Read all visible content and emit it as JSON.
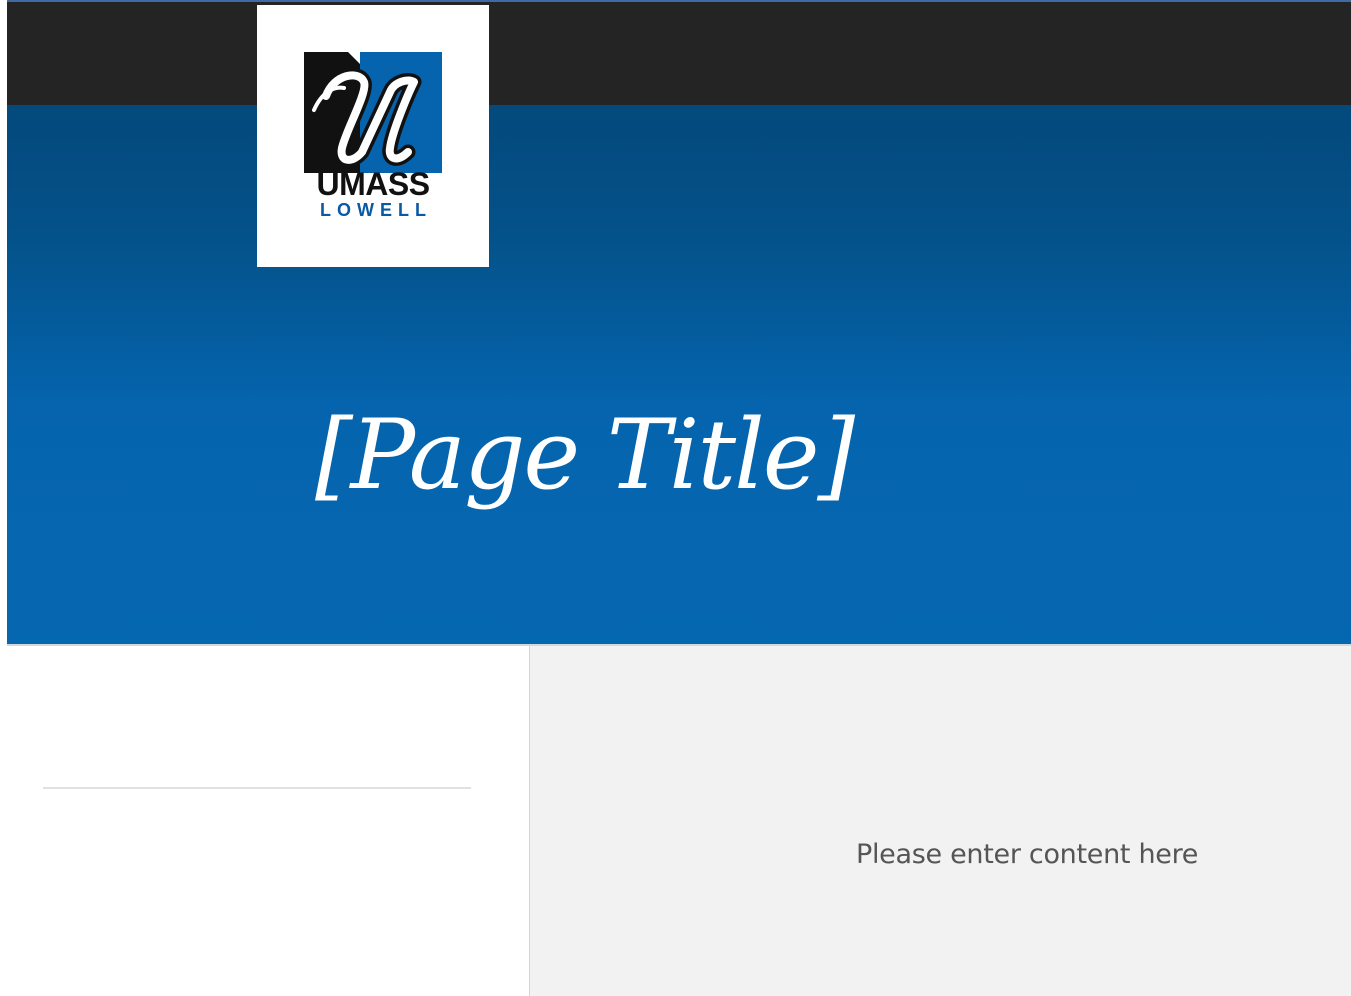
{
  "header": {
    "logo": {
      "word_top": "UMASS",
      "word_bottom": "LOWELL",
      "accent_color": "#0564ad",
      "dark_color": "#111111"
    }
  },
  "hero": {
    "title": "[Page Title]"
  },
  "main": {
    "content_placeholder": "Please enter content here"
  },
  "colors": {
    "top_bar": "#242424",
    "hero_top": "#03497c",
    "hero_bottom": "#0667b1",
    "content_bg": "#f2f2f2"
  }
}
